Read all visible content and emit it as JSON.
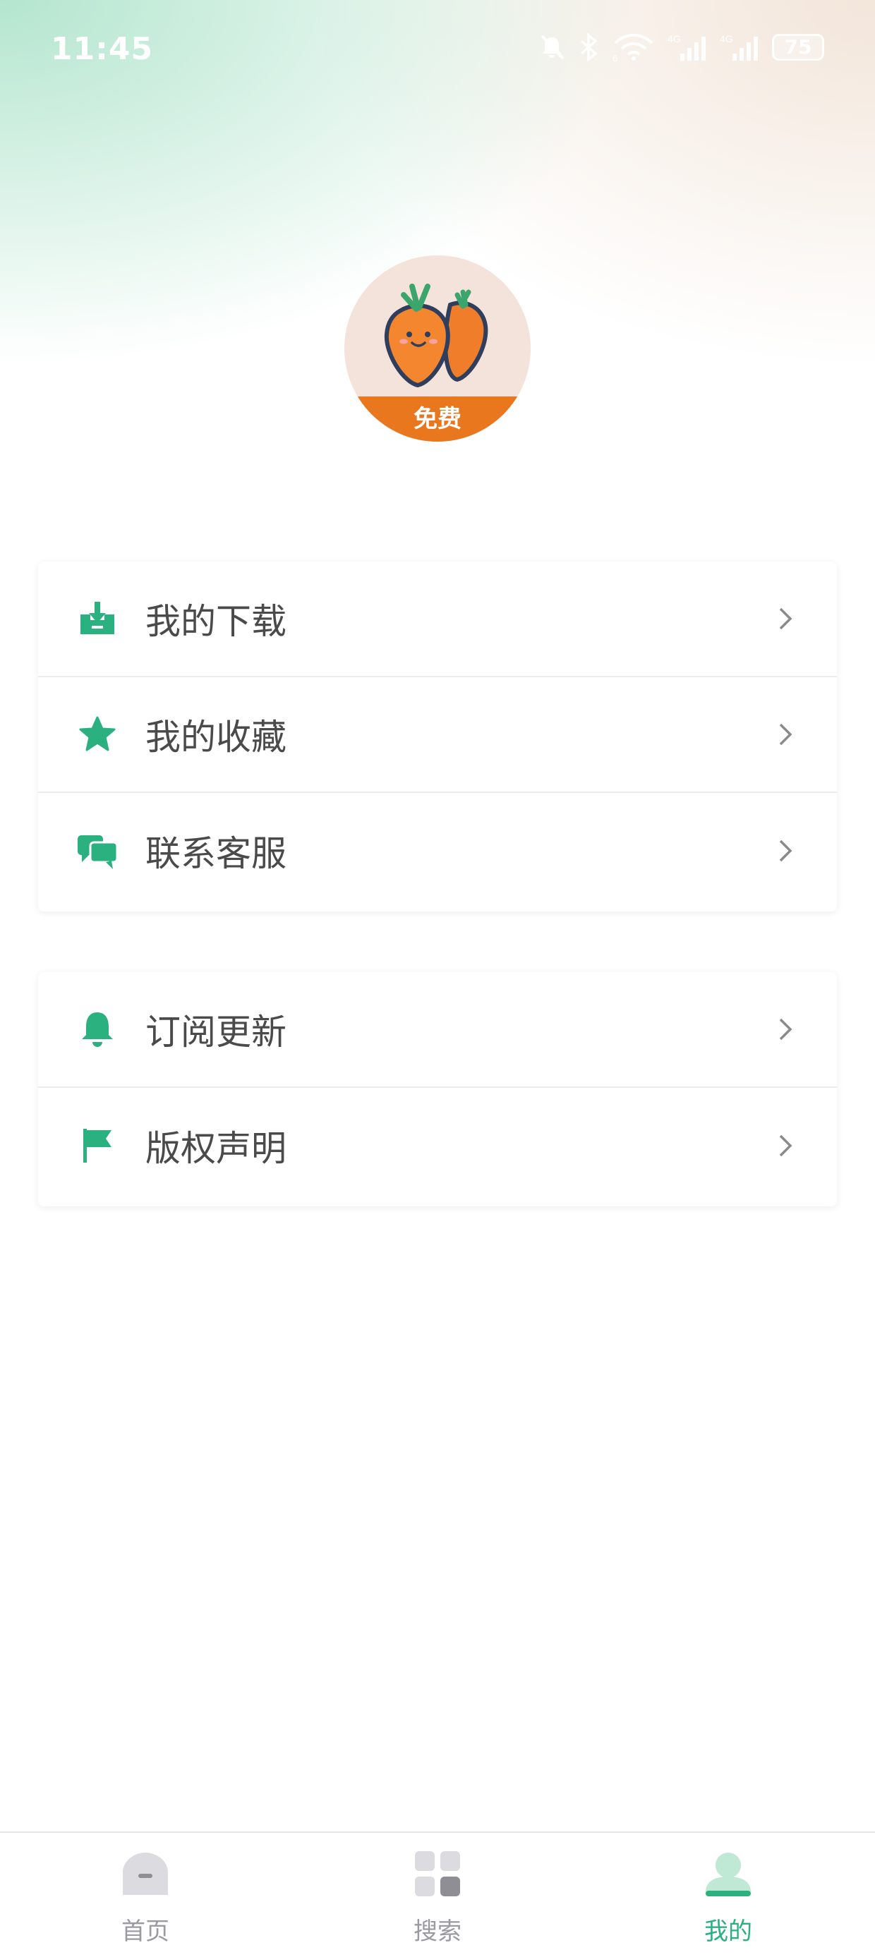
{
  "status_bar": {
    "time": "11:45",
    "battery_level": "75",
    "network_label_1": "4G",
    "network_label_2": "4G",
    "wifi_sub": "6",
    "icons": [
      "mute-icon",
      "bluetooth-icon",
      "wifi-icon",
      "signal-icon",
      "signal-icon",
      "battery-icon"
    ]
  },
  "profile": {
    "badge_label": "免费",
    "avatar_icon": "carrot-mascot-icon"
  },
  "menu_group_1": [
    {
      "label": "我的下载",
      "icon": "download-icon"
    },
    {
      "label": "我的收藏",
      "icon": "star-icon"
    },
    {
      "label": "联系客服",
      "icon": "chat-icon"
    }
  ],
  "menu_group_2": [
    {
      "label": "订阅更新",
      "icon": "bell-icon"
    },
    {
      "label": "版权声明",
      "icon": "flag-icon"
    }
  ],
  "tab_bar": {
    "tabs": [
      {
        "label": "首页",
        "icon": "home-icon"
      },
      {
        "label": "搜索",
        "icon": "grid-icon"
      },
      {
        "label": "我的",
        "icon": "user-icon",
        "active": true
      }
    ]
  },
  "colors": {
    "accent": "#2bb07f",
    "text": "#4a4a4a",
    "inactive": "#9a9aa0",
    "badge": "#e8771e"
  }
}
